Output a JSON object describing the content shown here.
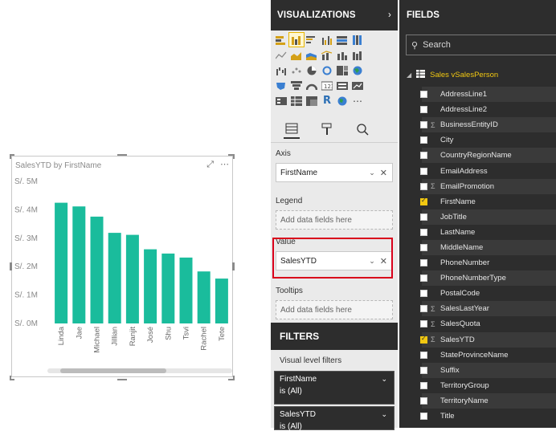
{
  "visual": {
    "title": "SalesYTD by FirstName",
    "focus_icon": "focus-mode-icon",
    "more_icon": "ellipsis-icon"
  },
  "chart_data": {
    "type": "bar",
    "title": "SalesYTD by FirstName",
    "categories": [
      "Linda",
      "Jae",
      "Michael",
      "Jillian",
      "Ranjit",
      "José",
      "Shu",
      "Tsvi",
      "Rachel",
      "Tete"
    ],
    "values": [
      4.25,
      4.12,
      3.76,
      3.19,
      3.12,
      2.61,
      2.46,
      2.32,
      1.83,
      1.58
    ],
    "y_ticks": [
      "S/. 0M",
      "S/. 1M",
      "S/. 2M",
      "S/. 3M",
      "S/. 4M",
      "S/. 5M"
    ],
    "ylim": [
      0,
      5
    ],
    "color": "#1abc9c",
    "grid": false
  },
  "visualizations": {
    "header": "VISUALIZATIONS",
    "collapse_icon": "chevron-right-icon",
    "axis_label": "Axis",
    "axis_value": "FirstName",
    "legend_label": "Legend",
    "legend_placeholder": "Add data fields here",
    "value_label": "Value",
    "value_value": "SalesYTD",
    "tooltips_label": "Tooltips",
    "tooltips_placeholder": "Add data fields here"
  },
  "filters": {
    "header": "FILTERS",
    "sub": "Visual level filters",
    "cards": [
      {
        "name": "FirstName",
        "state": "is (All)"
      },
      {
        "name": "SalesYTD",
        "state": "is (All)"
      }
    ]
  },
  "fields": {
    "header": "FIELDS",
    "search_placeholder": "Search",
    "table_name": "Sales vSalesPerson",
    "items": [
      {
        "name": "AddressLine1",
        "sigma": false,
        "checked": false
      },
      {
        "name": "AddressLine2",
        "sigma": false,
        "checked": false
      },
      {
        "name": "BusinessEntityID",
        "sigma": true,
        "checked": false
      },
      {
        "name": "City",
        "sigma": false,
        "checked": false
      },
      {
        "name": "CountryRegionName",
        "sigma": false,
        "checked": false
      },
      {
        "name": "EmailAddress",
        "sigma": false,
        "checked": false
      },
      {
        "name": "EmailPromotion",
        "sigma": true,
        "checked": false
      },
      {
        "name": "FirstName",
        "sigma": false,
        "checked": true
      },
      {
        "name": "JobTitle",
        "sigma": false,
        "checked": false
      },
      {
        "name": "LastName",
        "sigma": false,
        "checked": false
      },
      {
        "name": "MiddleName",
        "sigma": false,
        "checked": false
      },
      {
        "name": "PhoneNumber",
        "sigma": false,
        "checked": false
      },
      {
        "name": "PhoneNumberType",
        "sigma": false,
        "checked": false
      },
      {
        "name": "PostalCode",
        "sigma": false,
        "checked": false
      },
      {
        "name": "SalesLastYear",
        "sigma": true,
        "checked": false
      },
      {
        "name": "SalesQuota",
        "sigma": true,
        "checked": false
      },
      {
        "name": "SalesYTD",
        "sigma": true,
        "checked": true
      },
      {
        "name": "StateProvinceName",
        "sigma": false,
        "checked": false
      },
      {
        "name": "Suffix",
        "sigma": false,
        "checked": false
      },
      {
        "name": "TerritoryGroup",
        "sigma": false,
        "checked": false
      },
      {
        "name": "TerritoryName",
        "sigma": false,
        "checked": false
      },
      {
        "name": "Title",
        "sigma": false,
        "checked": false
      }
    ]
  }
}
